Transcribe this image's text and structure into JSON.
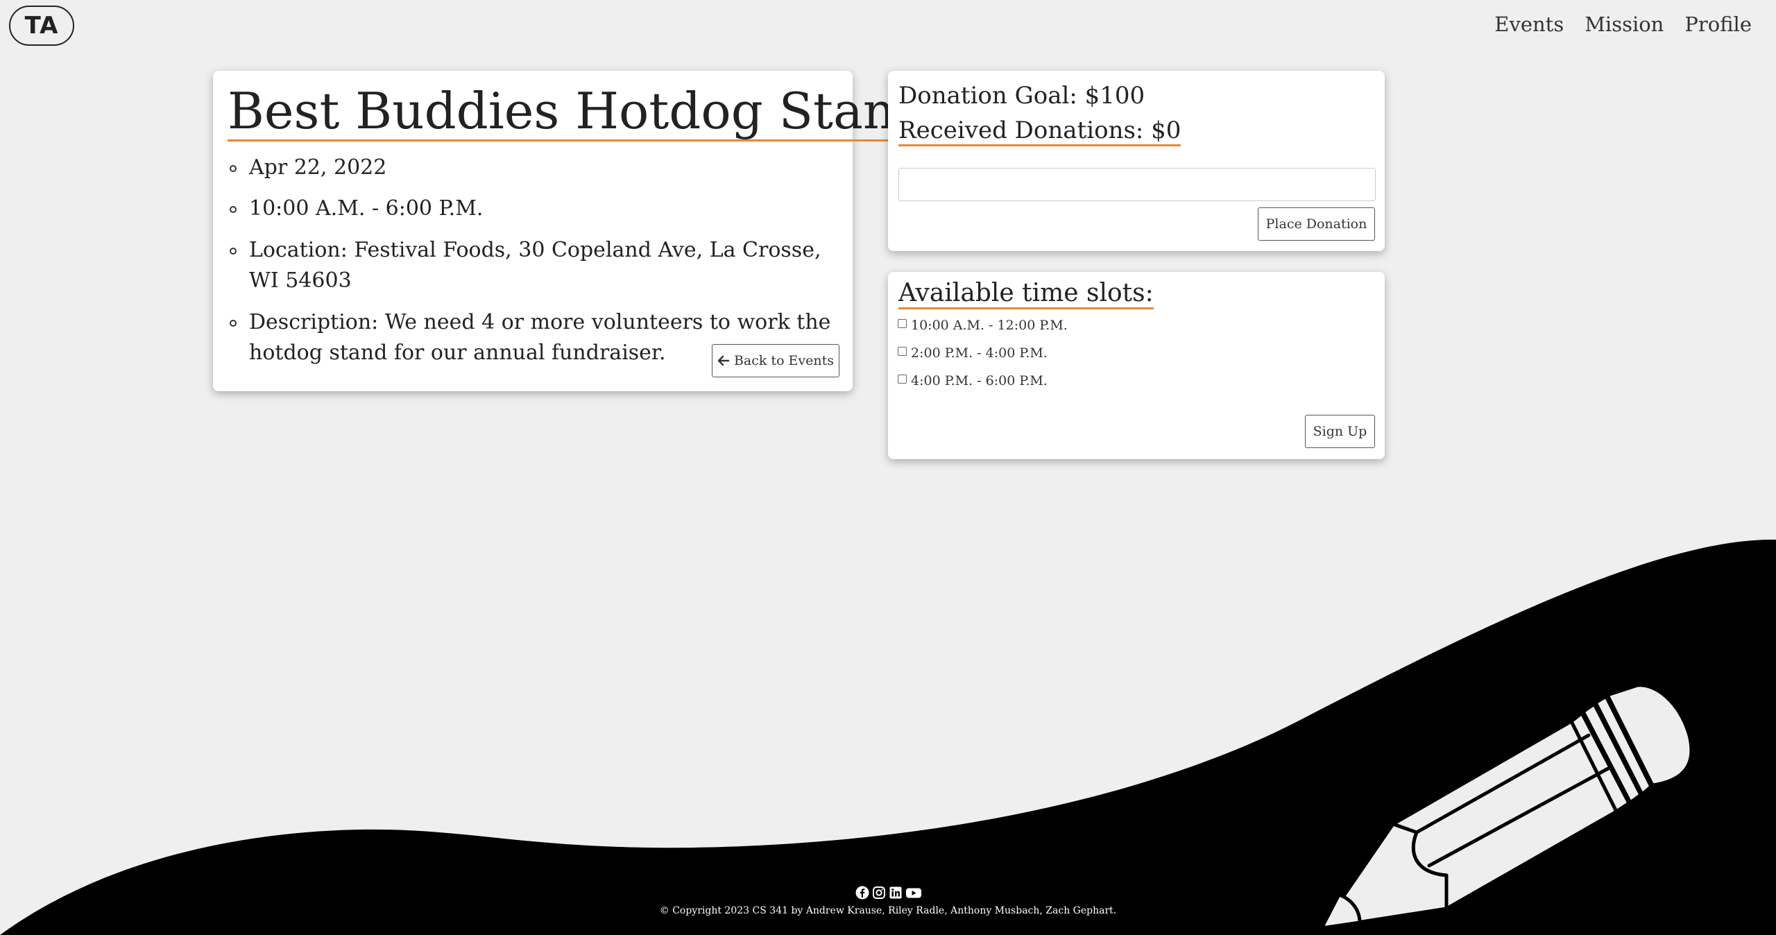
{
  "header": {
    "logo_text": "TA",
    "nav": [
      "Events",
      "Mission",
      "Profile"
    ]
  },
  "event": {
    "title": "Best Buddies Hotdog Stand",
    "details": [
      "Apr 22, 2022",
      "10:00 A.M. - 6:00 P.M.",
      "Location: Festival Foods, 30 Copeland Ave, La Crosse, WI 54603",
      "Description: We need 4 or more volunteers to work the hotdog stand for our annual fundraiser."
    ],
    "back_button": "Back to Events"
  },
  "donation": {
    "goal_text": "Donation Goal: $100",
    "received_text": "Received Donations: $0",
    "input_value": "",
    "button_label": "Place Donation"
  },
  "slots": {
    "title": "Available time slots:",
    "items": [
      {
        "label": "10:00 A.M. - 12:00 P.M.",
        "checked": false
      },
      {
        "label": "2:00 P.M. - 4:00 P.M.",
        "checked": false
      },
      {
        "label": "4:00 P.M. - 6:00 P.M.",
        "checked": false
      }
    ],
    "button_label": "Sign Up"
  },
  "footer": {
    "social_icons": [
      "facebook-icon",
      "instagram-icon",
      "linkedin-icon",
      "youtube-icon"
    ],
    "copyright": "© Copyright 2023 CS 341 by Andrew Krause, Riley Radle, Anthony Musbach, Zach Gephart."
  },
  "colors": {
    "background": "#efefef",
    "accent": "#e8873a",
    "footer": "#000000"
  }
}
